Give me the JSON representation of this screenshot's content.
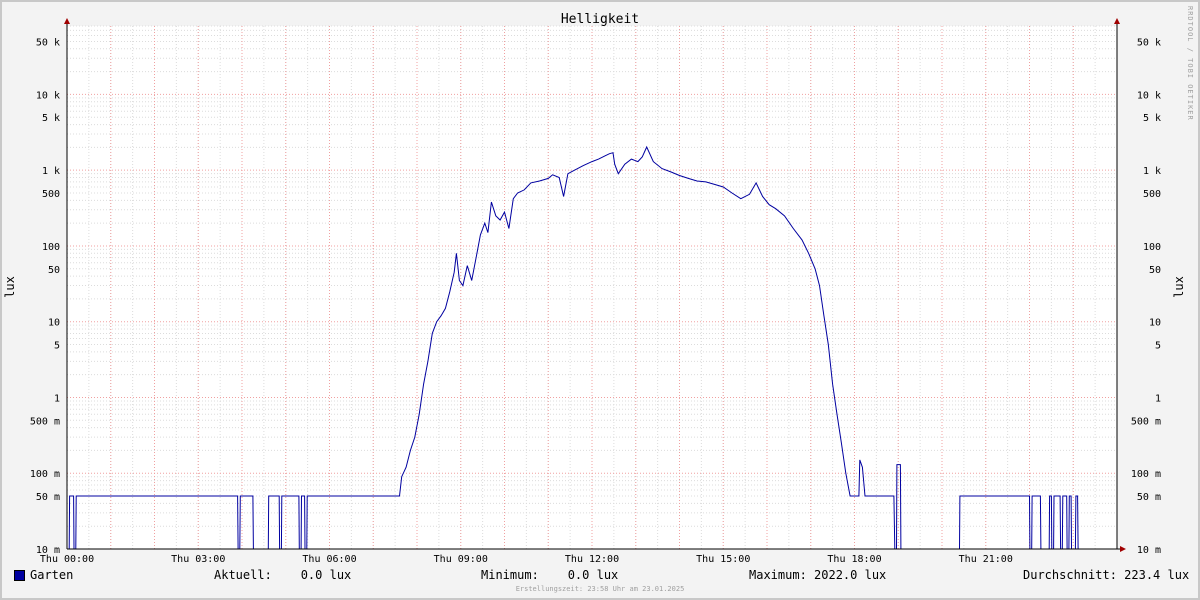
{
  "chart_data": {
    "type": "line",
    "title": "Helligkeit",
    "ylabel": "lux",
    "ylabel_right": "lux",
    "y_scale": "log",
    "ylim": [
      0.01,
      80000
    ],
    "y_ticks": [
      {
        "value": 50000,
        "label": "50 k"
      },
      {
        "value": 10000,
        "label": "10 k"
      },
      {
        "value": 5000,
        "label": "5 k"
      },
      {
        "value": 1000,
        "label": "1 k"
      },
      {
        "value": 500,
        "label": "500"
      },
      {
        "value": 100,
        "label": "100"
      },
      {
        "value": 50,
        "label": "50"
      },
      {
        "value": 10,
        "label": "10"
      },
      {
        "value": 5,
        "label": "5"
      },
      {
        "value": 1,
        "label": "1"
      },
      {
        "value": 0.5,
        "label": "500 m"
      },
      {
        "value": 0.1,
        "label": "100 m"
      },
      {
        "value": 0.05,
        "label": "50 m"
      },
      {
        "value": 0.01,
        "label": "10 m"
      }
    ],
    "x_ticks": [
      {
        "hour": 0,
        "label": "Thu 00:00"
      },
      {
        "hour": 3,
        "label": "Thu 03:00"
      },
      {
        "hour": 6,
        "label": "Thu 06:00"
      },
      {
        "hour": 9,
        "label": "Thu 09:00"
      },
      {
        "hour": 12,
        "label": "Thu 12:00"
      },
      {
        "hour": 15,
        "label": "Thu 15:00"
      },
      {
        "hour": 18,
        "label": "Thu 18:00"
      },
      {
        "hour": 21,
        "label": "Thu 21:00"
      }
    ],
    "xlim_hours": [
      0,
      24
    ],
    "grid": true,
    "series": [
      {
        "name": "Garten",
        "color": "#0000a0",
        "points": [
          [
            0.0,
            0.01
          ],
          [
            0.05,
            0.01
          ],
          [
            0.06,
            0.05
          ],
          [
            0.15,
            0.05
          ],
          [
            0.16,
            0.01
          ],
          [
            0.2,
            0.01
          ],
          [
            0.21,
            0.05
          ],
          [
            3.9,
            0.05
          ],
          [
            3.91,
            0.01
          ],
          [
            3.95,
            0.01
          ],
          [
            3.96,
            0.05
          ],
          [
            4.25,
            0.05
          ],
          [
            4.26,
            0.01
          ],
          [
            4.6,
            0.01
          ],
          [
            4.61,
            0.05
          ],
          [
            4.85,
            0.05
          ],
          [
            4.86,
            0.01
          ],
          [
            4.9,
            0.01
          ],
          [
            4.91,
            0.05
          ],
          [
            5.3,
            0.05
          ],
          [
            5.31,
            0.01
          ],
          [
            5.35,
            0.01
          ],
          [
            5.36,
            0.05
          ],
          [
            5.43,
            0.05
          ],
          [
            5.44,
            0.01
          ],
          [
            5.48,
            0.01
          ],
          [
            5.49,
            0.05
          ],
          [
            7.6,
            0.05
          ],
          [
            7.65,
            0.09
          ],
          [
            7.75,
            0.12
          ],
          [
            7.85,
            0.2
          ],
          [
            7.95,
            0.3
          ],
          [
            8.05,
            0.6
          ],
          [
            8.15,
            1.5
          ],
          [
            8.25,
            3
          ],
          [
            8.35,
            7
          ],
          [
            8.45,
            10
          ],
          [
            8.55,
            12
          ],
          [
            8.65,
            15
          ],
          [
            8.75,
            25
          ],
          [
            8.85,
            45
          ],
          [
            8.9,
            80
          ],
          [
            8.97,
            35
          ],
          [
            9.05,
            30
          ],
          [
            9.15,
            55
          ],
          [
            9.25,
            35
          ],
          [
            9.35,
            70
          ],
          [
            9.45,
            140
          ],
          [
            9.55,
            200
          ],
          [
            9.62,
            150
          ],
          [
            9.7,
            380
          ],
          [
            9.8,
            250
          ],
          [
            9.9,
            220
          ],
          [
            10.0,
            280
          ],
          [
            10.1,
            170
          ],
          [
            10.2,
            420
          ],
          [
            10.3,
            500
          ],
          [
            10.45,
            550
          ],
          [
            10.6,
            680
          ],
          [
            10.8,
            720
          ],
          [
            11.0,
            780
          ],
          [
            11.1,
            870
          ],
          [
            11.25,
            800
          ],
          [
            11.35,
            450
          ],
          [
            11.45,
            900
          ],
          [
            11.6,
            1000
          ],
          [
            11.8,
            1150
          ],
          [
            12.0,
            1300
          ],
          [
            12.15,
            1400
          ],
          [
            12.3,
            1550
          ],
          [
            12.4,
            1650
          ],
          [
            12.48,
            1700
          ],
          [
            12.52,
            1200
          ],
          [
            12.6,
            900
          ],
          [
            12.75,
            1200
          ],
          [
            12.9,
            1400
          ],
          [
            13.05,
            1300
          ],
          [
            13.15,
            1500
          ],
          [
            13.25,
            2022
          ],
          [
            13.4,
            1300
          ],
          [
            13.6,
            1050
          ],
          [
            13.8,
            950
          ],
          [
            14.0,
            850
          ],
          [
            14.2,
            780
          ],
          [
            14.4,
            720
          ],
          [
            14.6,
            700
          ],
          [
            14.8,
            650
          ],
          [
            15.0,
            600
          ],
          [
            15.2,
            500
          ],
          [
            15.4,
            420
          ],
          [
            15.6,
            480
          ],
          [
            15.75,
            680
          ],
          [
            15.9,
            450
          ],
          [
            16.05,
            350
          ],
          [
            16.2,
            310
          ],
          [
            16.4,
            250
          ],
          [
            16.6,
            170
          ],
          [
            16.8,
            120
          ],
          [
            16.95,
            80
          ],
          [
            17.1,
            50
          ],
          [
            17.2,
            30
          ],
          [
            17.3,
            12
          ],
          [
            17.4,
            5
          ],
          [
            17.5,
            1.5
          ],
          [
            17.6,
            0.6
          ],
          [
            17.7,
            0.25
          ],
          [
            17.8,
            0.1
          ],
          [
            17.9,
            0.05
          ],
          [
            18.1,
            0.05
          ],
          [
            18.12,
            0.15
          ],
          [
            18.18,
            0.12
          ],
          [
            18.24,
            0.05
          ],
          [
            18.9,
            0.05
          ],
          [
            18.92,
            0.01
          ],
          [
            18.96,
            0.01
          ],
          [
            18.97,
            0.13
          ],
          [
            19.05,
            0.13
          ],
          [
            19.06,
            0.01
          ],
          [
            20.4,
            0.01
          ],
          [
            20.41,
            0.05
          ],
          [
            22.0,
            0.05
          ],
          [
            22.01,
            0.01
          ],
          [
            22.05,
            0.01
          ],
          [
            22.06,
            0.05
          ],
          [
            22.25,
            0.05
          ],
          [
            22.26,
            0.01
          ],
          [
            22.45,
            0.01
          ],
          [
            22.46,
            0.05
          ],
          [
            22.5,
            0.05
          ],
          [
            22.51,
            0.01
          ],
          [
            22.55,
            0.01
          ],
          [
            22.56,
            0.05
          ],
          [
            22.7,
            0.05
          ],
          [
            22.71,
            0.01
          ],
          [
            22.75,
            0.01
          ],
          [
            22.76,
            0.05
          ],
          [
            22.85,
            0.05
          ],
          [
            22.86,
            0.01
          ],
          [
            22.9,
            0.01
          ],
          [
            22.91,
            0.05
          ],
          [
            22.95,
            0.05
          ],
          [
            22.96,
            0.01
          ],
          [
            23.05,
            0.01
          ],
          [
            23.06,
            0.05
          ],
          [
            23.1,
            0.05
          ],
          [
            23.11,
            0.01
          ],
          [
            24.0,
            0.01
          ]
        ]
      }
    ]
  },
  "legend": {
    "series_name": "Garten",
    "current": "Aktuell:    0.0 lux",
    "minimum": "Minimum:    0.0 lux",
    "maximum": "Maximum: 2022.0 lux",
    "average": "Durchschnitt: 223.4 lux"
  },
  "footer": "Erstellungszeit: 23:58 Uhr am 23.01.2025",
  "watermark": "RRDTOOL / TOBI OETIKER"
}
